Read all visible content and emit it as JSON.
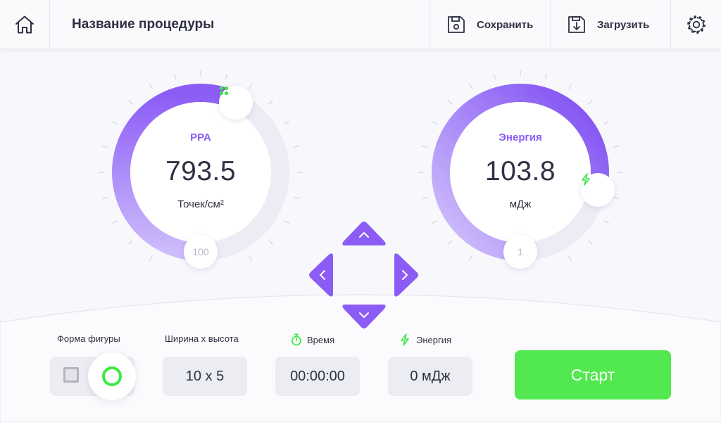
{
  "header": {
    "title": "Название процедуры",
    "save_label": "Сохранить",
    "load_label": "Загрузить"
  },
  "gauges": {
    "ppa": {
      "label": "PPA",
      "value": "793.5",
      "unit": "Точек/см²",
      "min_label": "100"
    },
    "energy": {
      "label": "Энергия",
      "value": "103.8",
      "unit": "мДж",
      "min_label": "1"
    }
  },
  "controls": {
    "shape": {
      "label": "Форма фигуры",
      "selected": "circle"
    },
    "size": {
      "label": "Ширина х высота",
      "value": "10 x 5"
    },
    "time": {
      "label": "Время",
      "value": "00:00:00"
    },
    "energy": {
      "label": "Энергия",
      "value": "0 мДж"
    },
    "start_label": "Старт"
  },
  "colors": {
    "accent": "#8b5cf6",
    "accent_light": "#c8b4fb",
    "track": "#ececf5",
    "green": "#3ee843",
    "start": "#52e84f"
  },
  "icons": {
    "home": "home-icon",
    "save": "floppy-disk-icon",
    "load": "floppy-download-icon",
    "settings": "gear-icon",
    "ppa_knob": "dots-grid-icon",
    "energy_knob": "lightning-icon",
    "time": "stopwatch-icon",
    "energy": "lightning-icon"
  }
}
